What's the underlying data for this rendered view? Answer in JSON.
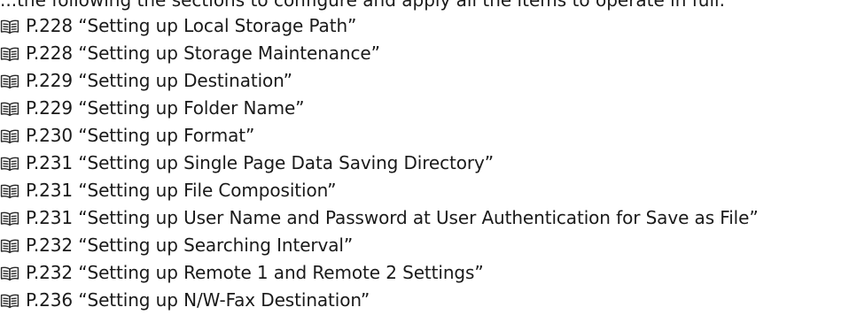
{
  "top_fragment": "...the following the sections to configure and apply all the items to operate in full.",
  "references": [
    {
      "icon": "book-icon",
      "text": "P.228 “Setting up Local Storage Path”"
    },
    {
      "icon": "book-icon",
      "text": "P.228 “Setting up Storage Maintenance”"
    },
    {
      "icon": "book-icon",
      "text": "P.229 “Setting up Destination”"
    },
    {
      "icon": "book-icon",
      "text": "P.229 “Setting up Folder Name”"
    },
    {
      "icon": "book-icon",
      "text": "P.230 “Setting up Format”"
    },
    {
      "icon": "book-icon",
      "text": "P.231 “Setting up Single Page Data Saving Directory”"
    },
    {
      "icon": "book-icon",
      "text": "P.231 “Setting up File Composition”"
    },
    {
      "icon": "book-icon",
      "text": "P.231 “Setting up User Name and Password at User Authentication for Save as File”"
    },
    {
      "icon": "book-icon",
      "text": "P.232 “Setting up Searching Interval”"
    },
    {
      "icon": "book-icon",
      "text": "P.232 “Setting up Remote 1 and Remote 2 Settings”"
    },
    {
      "icon": "book-icon",
      "text": "P.236 “Setting up N/W-Fax Destination”"
    }
  ]
}
